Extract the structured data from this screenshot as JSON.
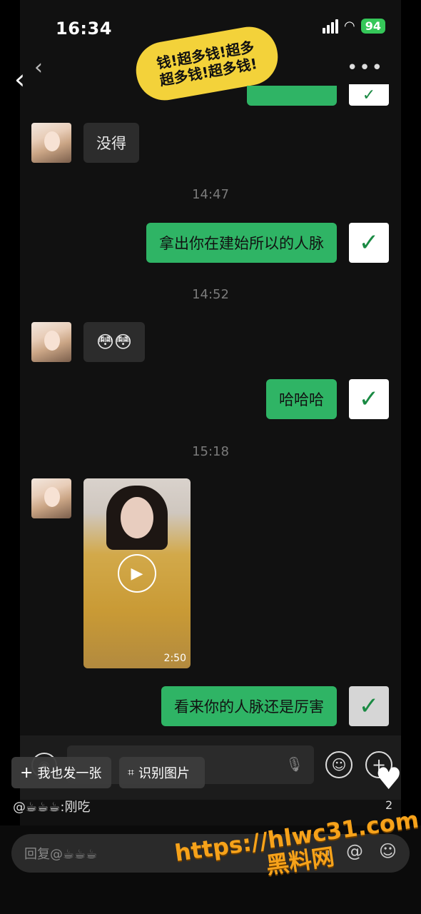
{
  "status": {
    "time": "16:34",
    "battery": "94"
  },
  "sticker": {
    "line1": "钱!超多钱!超多",
    "line2": "超多钱!超多钱!"
  },
  "messages": {
    "m1": {
      "text": "没得"
    },
    "t1": "14:47",
    "m2": {
      "text": "拿出你在建始所以的人脉"
    },
    "t2": "14:52",
    "m3": {
      "text": "😳😳"
    },
    "m4": {
      "text": "哈哈哈"
    },
    "t3": "15:18",
    "video": {
      "duration": "2:50"
    },
    "m5": {
      "text": "看来你的人脉还是厉害"
    }
  },
  "actions": {
    "post_label": "我也发一张",
    "identify_label": "识别图片"
  },
  "comment": {
    "text": "@☕☕☕:刚吃"
  },
  "likes": {
    "count": "2"
  },
  "reply": {
    "placeholder": "回复@☕☕☕"
  },
  "watermark": {
    "url": "https://hlwc31.com",
    "name": "黑料网"
  },
  "colors": {
    "green_bubble": "#2fb465",
    "battery": "#35c759",
    "watermark": "#f6a21a"
  }
}
